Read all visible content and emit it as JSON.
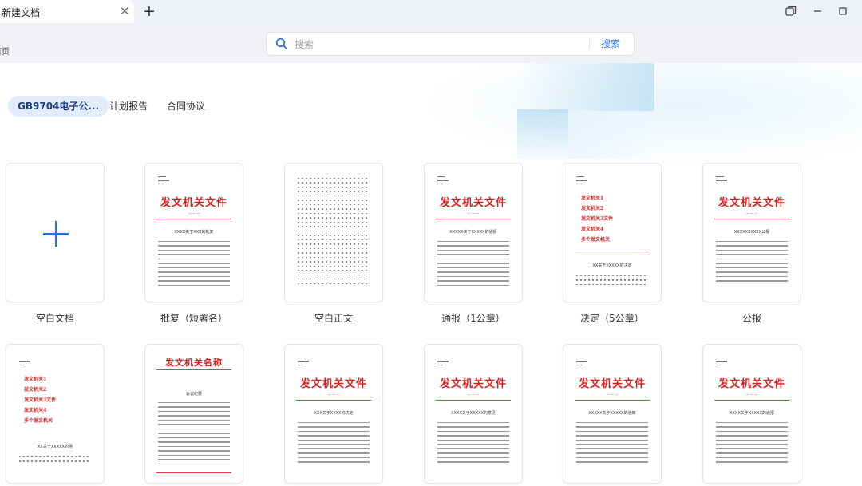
{
  "window": {
    "tab_title": "新建文档",
    "left_crop_text": "首页"
  },
  "search": {
    "placeholder": "搜索",
    "button_label": "搜索"
  },
  "categories": [
    {
      "label": "GB9704电子公...",
      "active": true
    },
    {
      "label": "计划报告",
      "active": false
    },
    {
      "label": "合同协议",
      "active": false
    }
  ],
  "templates_row1": [
    {
      "label": "空白文档"
    },
    {
      "label": "批复（短署名）",
      "thumb_title": "发文机关文件",
      "thumb_heading": "XXXX关于XXX的批复"
    },
    {
      "label": "空白正文"
    },
    {
      "label": "通报（1公章）",
      "thumb_title": "发文机关文件",
      "thumb_heading": "XXXXX关于XXXXX的通报"
    },
    {
      "label": "决定（5公章）",
      "thumb_rows": [
        "发文机关1",
        "发文机关2",
        "发文机关3文件",
        "发文机关4",
        "多个发文机关"
      ],
      "thumb_heading": "XX关于XXXXX的决定"
    },
    {
      "label": "公报",
      "thumb_title": "发文机关文件",
      "thumb_heading": "XXXXXXXXXX公报"
    }
  ],
  "templates_row2": [
    {
      "thumb_rows": [
        "发文机关1",
        "发文机关2",
        "发文机关3文件",
        "发文机关4",
        "多个发文机关"
      ],
      "thumb_heading": "XX关于XXXXX的函"
    },
    {
      "thumb_title": "发文机关名称",
      "thumb_heading": "会议纪要"
    },
    {
      "thumb_title": "发文机关文件",
      "thumb_heading": "XXX关于XXXX的决定"
    },
    {
      "thumb_title": "发文机关文件",
      "thumb_heading": "XXXX关于XXXXX的意见"
    },
    {
      "thumb_title": "发文机关文件",
      "thumb_heading": "XXXXX关于XXXXX的通知"
    },
    {
      "thumb_title": "发文机关文件",
      "thumb_heading": "XXXX关于XXXXX的通报"
    }
  ],
  "colors": {
    "accent": "#2b6fd6",
    "doc_red": "#d81e1e",
    "active_chip_bg": "#e3ecfa"
  }
}
